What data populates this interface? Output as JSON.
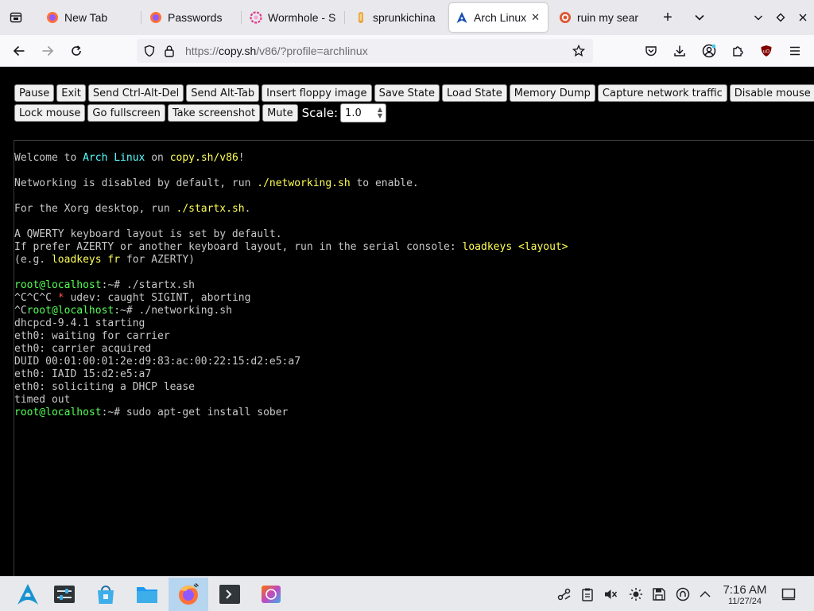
{
  "browser": {
    "tabs": [
      {
        "title": "New Tab",
        "icon": "firefox-icon",
        "active": false
      },
      {
        "title": "Passwords",
        "icon": "firefox-icon",
        "active": false
      },
      {
        "title": "Wormhole - S",
        "icon": "wormhole-icon",
        "active": false
      },
      {
        "title": "sprunkichina",
        "icon": "sprunki-icon",
        "active": false
      },
      {
        "title": "Arch Linux",
        "icon": "arch-icon",
        "active": true
      },
      {
        "title": "ruin my sear",
        "icon": "duckduckgo-icon",
        "active": false
      }
    ],
    "new_tab_symbol": "+",
    "close_symbol": "✕",
    "url": {
      "scheme": "https://",
      "host": "copy.sh",
      "path": "/v86/?profile=archlinux"
    }
  },
  "v86": {
    "buttons_row1": [
      "Pause",
      "Exit",
      "Send Ctrl-Alt-Del",
      "Send Alt-Tab",
      "Insert floppy image",
      "Save State",
      "Load State",
      "Memory Dump",
      "Capture network traffic",
      "Disable mouse"
    ],
    "buttons_row2": [
      "Lock mouse",
      "Go fullscreen",
      "Take screenshot",
      "Mute"
    ],
    "scale_label": "Scale:",
    "scale_value": "1.0"
  },
  "terminal": {
    "lines": [
      [
        {
          "t": "Welcome to "
        },
        {
          "t": "Arch Linux",
          "c": "c"
        },
        {
          "t": " on "
        },
        {
          "t": "copy.sh/v86",
          "c": "y"
        },
        {
          "t": "!"
        }
      ],
      [],
      [
        {
          "t": "Networking is disabled by default, run "
        },
        {
          "t": "./networking.sh",
          "c": "y"
        },
        {
          "t": " to enable."
        }
      ],
      [],
      [
        {
          "t": "For the Xorg desktop, run "
        },
        {
          "t": "./startx.sh",
          "c": "y"
        },
        {
          "t": "."
        }
      ],
      [],
      [
        {
          "t": "A QWERTY keyboard layout is set by default."
        }
      ],
      [
        {
          "t": "If prefer AZERTY or another keyboard layout, run in the serial console: "
        },
        {
          "t": "loadkeys <layout>",
          "c": "y"
        }
      ],
      [
        {
          "t": "(e.g. "
        },
        {
          "t": "loadkeys fr",
          "c": "y"
        },
        {
          "t": " for AZERTY)"
        }
      ],
      [],
      [
        {
          "t": "root@localhost",
          "c": "g"
        },
        {
          "t": ":~# ./startx.sh"
        }
      ],
      [
        {
          "t": "^C^C^C "
        },
        {
          "t": "*",
          "c": "r"
        },
        {
          "t": " udev: caught SIGINT, aborting"
        }
      ],
      [
        {
          "t": "^C"
        },
        {
          "t": "root@localhost",
          "c": "g"
        },
        {
          "t": ":~# ./networking.sh"
        }
      ],
      [
        {
          "t": "dhcpcd-9.4.1 starting"
        }
      ],
      [
        {
          "t": "eth0: waiting for carrier"
        }
      ],
      [
        {
          "t": "eth0: carrier acquired"
        }
      ],
      [
        {
          "t": "DUID 00:01:00:01:2e:d9:83:ac:00:22:15:d2:e5:a7"
        }
      ],
      [
        {
          "t": "eth0: IAID 15:d2:e5:a7"
        }
      ],
      [
        {
          "t": "eth0: soliciting a DHCP lease"
        }
      ],
      [
        {
          "t": "timed out"
        }
      ],
      [
        {
          "t": "root@localhost",
          "c": "g"
        },
        {
          "t": ":~# sudo apt-get install sober"
        }
      ]
    ]
  },
  "taskbar": {
    "apps": [
      {
        "icon": "arch-launcher-icon",
        "active": false
      },
      {
        "icon": "system-settings-icon",
        "active": false
      },
      {
        "icon": "discover-store-icon",
        "active": false
      },
      {
        "icon": "file-manager-icon",
        "active": false
      },
      {
        "icon": "firefox-icon",
        "active": true
      },
      {
        "icon": "terminal-icon",
        "active": false
      },
      {
        "icon": "image-viewer-icon",
        "active": false
      }
    ],
    "tray": [
      "network-icon",
      "clipboard-icon",
      "volume-muted-icon",
      "brightness-icon",
      "save-icon",
      "updates-icon",
      "tray-expand-icon"
    ],
    "time": "7:16 AM",
    "date": "11/27/24"
  },
  "colors": {
    "terminal_yellow": "#ffff55",
    "terminal_cyan": "#55ffff",
    "terminal_green": "#55ff55",
    "terminal_red": "#ff5555",
    "taskbar_active": "#b6d5ef"
  }
}
